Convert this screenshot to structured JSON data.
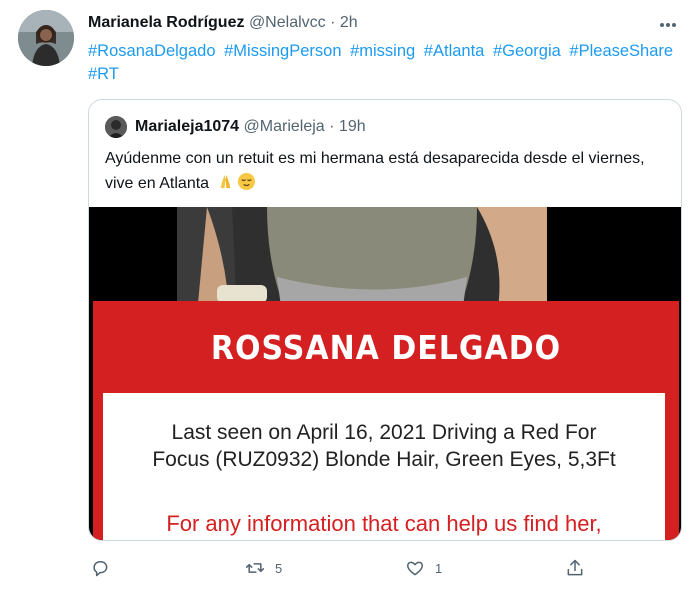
{
  "tweet": {
    "author_name": "Marianela Rodríguez",
    "author_handle": "@Nelalvcc",
    "separator": "·",
    "time": "2h",
    "hashtags": [
      "#RosanaDelgado",
      "#MissingPerson",
      "#missing",
      "#Atlanta",
      "#Georgia",
      "#PleaseShare",
      "#RT"
    ],
    "replies": "",
    "retweets": "5",
    "likes": "1"
  },
  "quoted": {
    "author_name": "Marialeja1074",
    "author_handle": "@Marieleja",
    "separator": "·",
    "time": "19h",
    "text": "Ayúdenme con un retuit es mi hermana está desaparecida desde el viernes, vive en Atlanta",
    "emojis": [
      "folded-hands",
      "relieved-face"
    ]
  },
  "flyer": {
    "name": "ROSSANA DELGADO",
    "details_line1": "Last seen on April 16, 2021  Driving a Red For",
    "details_line2": "Focus (RUZ0932) Blonde Hair, Green Eyes, 5,3Ft",
    "info_text": "For any information that can help us find her,",
    "red_color": "#d42021"
  },
  "colors": {
    "link": "#1d9bf0",
    "secondary_text": "#536471",
    "border": "#cfd9de"
  }
}
